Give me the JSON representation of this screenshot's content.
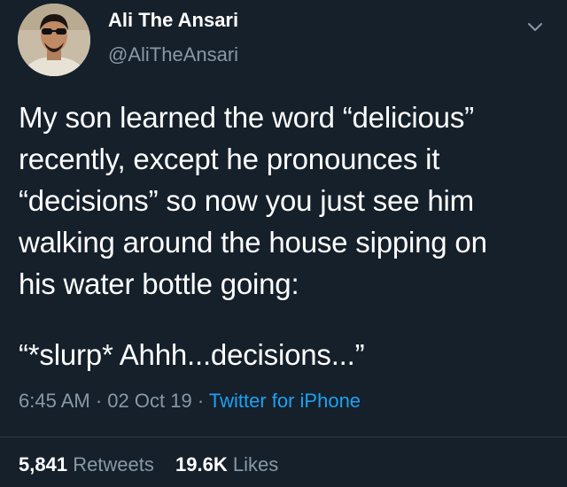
{
  "author": {
    "display_name": "Ali The Ansari",
    "handle": "@AliTheAnsari",
    "avatar_icon": "user-avatar-photo"
  },
  "tweet": {
    "text": "My son learned the word “delicious”\nrecently, except he pronounces it\n“decisions” so now you just see him\nwalking around the house sipping on\nhis water bottle going:",
    "quote": "“*slurp* Ahhh...decisions...”"
  },
  "meta": {
    "time": "6:45 AM",
    "date": "02 Oct 19",
    "separator": "·",
    "source": "Twitter for iPhone"
  },
  "stats": {
    "retweets_count": "5,841",
    "retweets_label": "Retweets",
    "likes_count": "19.6K",
    "likes_label": "Likes"
  },
  "colors": {
    "background": "#15202b",
    "text_primary": "#ffffff",
    "text_secondary": "#8899a6",
    "link": "#1da1f2"
  }
}
